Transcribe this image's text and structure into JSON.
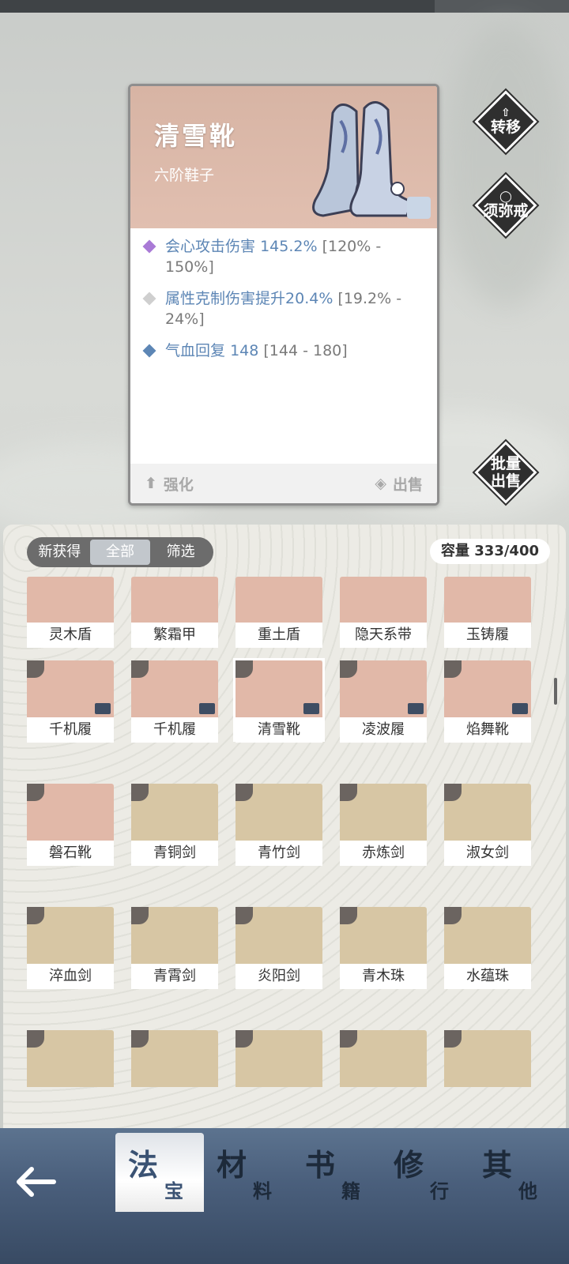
{
  "detail": {
    "name": "清雪靴",
    "type": "六阶鞋子",
    "stats": [
      {
        "label": "会心攻击伤害",
        "value": "145.2%",
        "range": "[120% - 150%]",
        "color": "#a97ad6"
      },
      {
        "label": "属性克制伤害提升",
        "value": "20.4%",
        "range": "[19.2% - 24%]",
        "color": "#cfcfcf"
      },
      {
        "label": "气血回复",
        "value": "148",
        "range": "[144 - 180]",
        "color": "#5d86b5"
      }
    ],
    "enhance_label": "强化",
    "sell_label": "出售"
  },
  "side_buttons": {
    "transfer": "转移",
    "ring": "须弥戒",
    "bulk_sell_1": "批量",
    "bulk_sell_2": "出售"
  },
  "filters": {
    "tabs": [
      "新获得",
      "全部",
      "筛选"
    ],
    "active": "全部"
  },
  "capacity": "容量 333/400",
  "items": [
    {
      "name": "灵木盾",
      "bg": "rose"
    },
    {
      "name": "繁霜甲",
      "bg": "rose"
    },
    {
      "name": "重土盾",
      "bg": "rose"
    },
    {
      "name": "隐天系带",
      "bg": "rose"
    },
    {
      "name": "玉铸履",
      "bg": "rose"
    },
    {
      "name": "千机履",
      "bg": "rose"
    },
    {
      "name": "千机履",
      "bg": "rose"
    },
    {
      "name": "清雪靴",
      "bg": "rose"
    },
    {
      "name": "凌波履",
      "bg": "rose"
    },
    {
      "name": "焰舞靴",
      "bg": "rose"
    },
    {
      "name": "磐石靴",
      "bg": "rose"
    },
    {
      "name": "青铜剑",
      "bg": "tan"
    },
    {
      "name": "青竹剑",
      "bg": "tan"
    },
    {
      "name": "赤炼剑",
      "bg": "tan"
    },
    {
      "name": "淑女剑",
      "bg": "tan"
    },
    {
      "name": "淬血剑",
      "bg": "tan"
    },
    {
      "name": "青霄剑",
      "bg": "tan"
    },
    {
      "name": "炎阳剑",
      "bg": "tan"
    },
    {
      "name": "青木珠",
      "bg": "tan"
    },
    {
      "name": "水蕴珠",
      "bg": "tan"
    },
    {
      "name": "",
      "bg": "tan"
    },
    {
      "name": "",
      "bg": "tan"
    },
    {
      "name": "",
      "bg": "tan"
    },
    {
      "name": "",
      "bg": "tan"
    },
    {
      "name": "",
      "bg": "tan"
    }
  ],
  "nav": [
    {
      "big": "法",
      "small": "宝",
      "active": true
    },
    {
      "big": "材",
      "small": "料",
      "active": false
    },
    {
      "big": "书",
      "small": "籍",
      "active": false
    },
    {
      "big": "修",
      "small": "行",
      "active": false
    },
    {
      "big": "其",
      "small": "他",
      "active": false
    }
  ],
  "colors": {
    "rose": "#e1b8a8",
    "tan": "#d7c6a4",
    "nav": "#4a5f7c"
  }
}
